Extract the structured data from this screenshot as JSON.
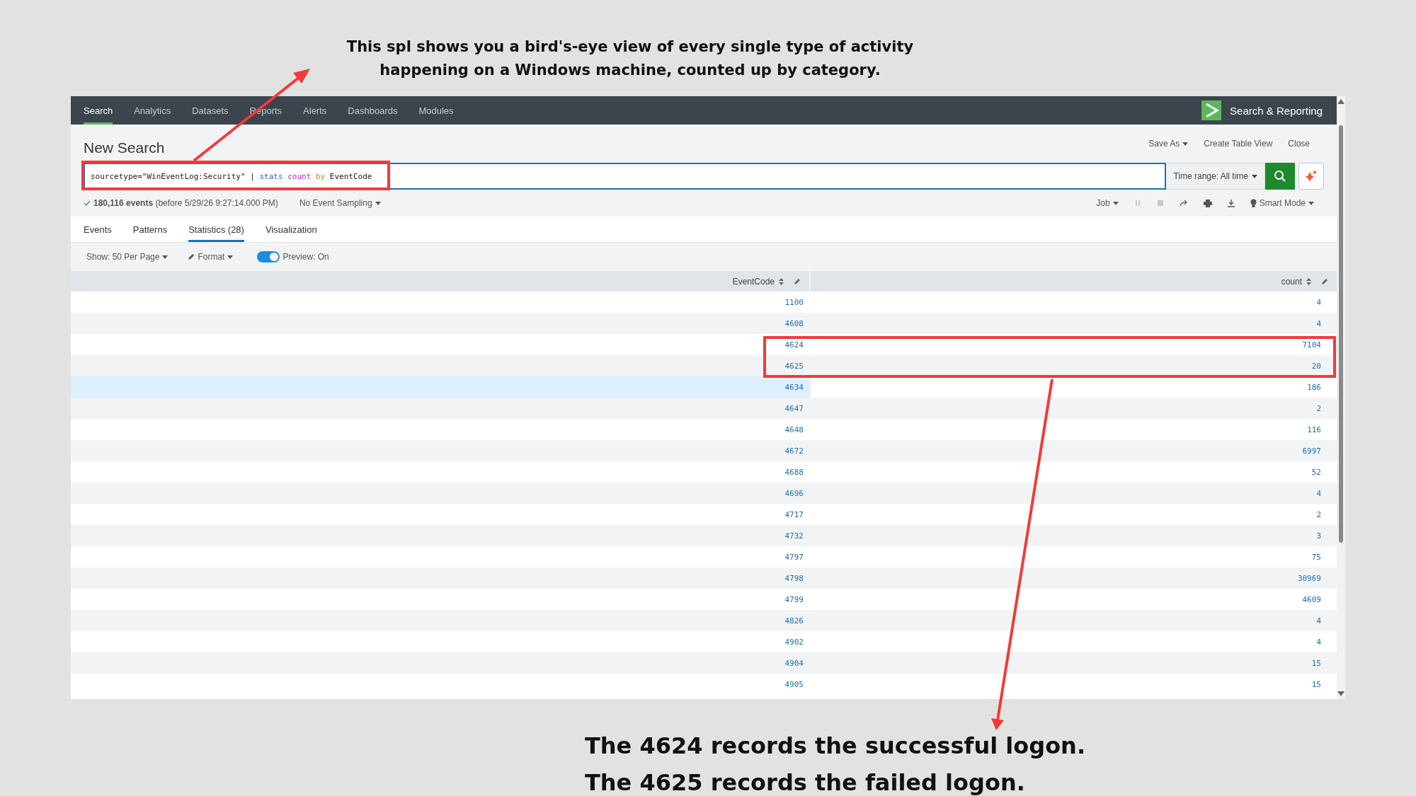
{
  "caption_top": "This spl shows you a bird's-eye view of every single type of activity happening on a Windows machine, counted up by category.",
  "app": {
    "nav": [
      {
        "label": "Search",
        "selected": true
      },
      {
        "label": "Analytics",
        "selected": false
      },
      {
        "label": "Datasets",
        "selected": false
      },
      {
        "label": "Reports",
        "selected": false
      },
      {
        "label": "Alerts",
        "selected": false
      },
      {
        "label": "Dashboards",
        "selected": false
      },
      {
        "label": "Modules",
        "selected": false
      }
    ],
    "app_name": "Search & Reporting",
    "page_title": "New Search",
    "actions": [
      {
        "label": "Save As",
        "dropdown": true
      },
      {
        "label": "Create Table View",
        "dropdown": false
      },
      {
        "label": "Close",
        "dropdown": false
      }
    ],
    "query": [
      {
        "text": "sourcetype=\"WinEventLog:Security\" | ",
        "kind": "plain"
      },
      {
        "text": "stats ",
        "kind": "command"
      },
      {
        "text": "count ",
        "kind": "function"
      },
      {
        "text": "by ",
        "kind": "keyword"
      },
      {
        "text": "EventCode",
        "kind": "plain"
      }
    ],
    "time_range": "Time range: All time",
    "status": "**180,116 events** (before 5/29/26 9:27:14.000 PM)",
    "sampling": "No Event Sampling",
    "job": "Job",
    "mode": "Smart Mode",
    "tabs": [
      {
        "label": "Events",
        "selected": false
      },
      {
        "label": "Patterns",
        "selected": false
      },
      {
        "label": "Statistics (28)",
        "selected": true
      },
      {
        "label": "Visualization",
        "selected": false
      }
    ],
    "per_page": "Show: 50 Per Page",
    "format": "Format",
    "preview": {
      "label": "Preview: On",
      "on": true
    },
    "table": {
      "columns": [
        "EventCode",
        "count"
      ],
      "rows": [
        {
          "cells": [
            "1100",
            "4"
          ],
          "highlighted": false
        },
        {
          "cells": [
            "4608",
            "4"
          ],
          "highlighted": false
        },
        {
          "cells": [
            "4624",
            "7104"
          ],
          "highlighted": false
        },
        {
          "cells": [
            "4625",
            "20"
          ],
          "highlighted": false
        },
        {
          "cells": [
            "4634",
            "186"
          ],
          "highlighted": true
        },
        {
          "cells": [
            "4647",
            "2"
          ],
          "highlighted": false
        },
        {
          "cells": [
            "4648",
            "116"
          ],
          "highlighted": false
        },
        {
          "cells": [
            "4672",
            "6997"
          ],
          "highlighted": false
        },
        {
          "cells": [
            "4688",
            "52"
          ],
          "highlighted": false
        },
        {
          "cells": [
            "4696",
            "4"
          ],
          "highlighted": false
        },
        {
          "cells": [
            "4717",
            "2"
          ],
          "highlighted": false
        },
        {
          "cells": [
            "4732",
            "3"
          ],
          "highlighted": false
        },
        {
          "cells": [
            "4797",
            "75"
          ],
          "highlighted": false
        },
        {
          "cells": [
            "4798",
            "30969"
          ],
          "highlighted": false
        },
        {
          "cells": [
            "4799",
            "4609"
          ],
          "highlighted": false
        },
        {
          "cells": [
            "4826",
            "4"
          ],
          "highlighted": false
        },
        {
          "cells": [
            "4902",
            "4"
          ],
          "highlighted": false
        },
        {
          "cells": [
            "4904",
            "15"
          ],
          "highlighted": false
        },
        {
          "cells": [
            "4905",
            "15"
          ],
          "highlighted": false
        }
      ]
    }
  },
  "caption_bottom": [
    "The 4624 records the successful logon.",
    "The 4625 records the failed logon."
  ]
}
